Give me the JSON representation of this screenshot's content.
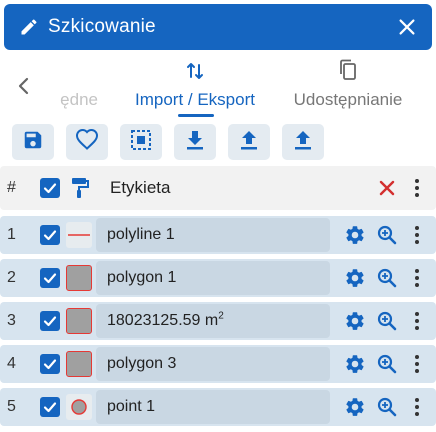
{
  "header": {
    "title": "Szkicowanie",
    "background": "#1565c0"
  },
  "tabs": [
    {
      "label": "ędne",
      "state": "partially-hidden"
    },
    {
      "label": "Import / Eksport",
      "state": "active"
    },
    {
      "label": "Udostępnianie",
      "state": "inactive"
    }
  ],
  "toolbar": {
    "buttons": [
      "save-icon",
      "heart-icon",
      "select-all-icon",
      "download-icon",
      "upload-icon",
      "upload-icon"
    ]
  },
  "table": {
    "header": {
      "num": "#",
      "label": "Etykieta"
    },
    "rows": [
      {
        "num": "1",
        "label": "polyline 1",
        "unit": "",
        "symbol": "polyline"
      },
      {
        "num": "2",
        "label": "polygon 1",
        "unit": "",
        "symbol": "polygon"
      },
      {
        "num": "3",
        "label": "18023125.59 m",
        "unit": "2",
        "symbol": "polygon"
      },
      {
        "num": "4",
        "label": "polygon 3",
        "unit": "",
        "symbol": "polygon"
      },
      {
        "num": "5",
        "label": "point 1",
        "unit": "",
        "symbol": "point"
      }
    ]
  },
  "colors": {
    "accent": "#1565c0",
    "row_background": "#d7e4ef",
    "field_background": "#c9d7e3",
    "delete": "#d32f2f",
    "symbol_stroke": "#e53935",
    "symbol_fill": "#a0a0a0"
  }
}
